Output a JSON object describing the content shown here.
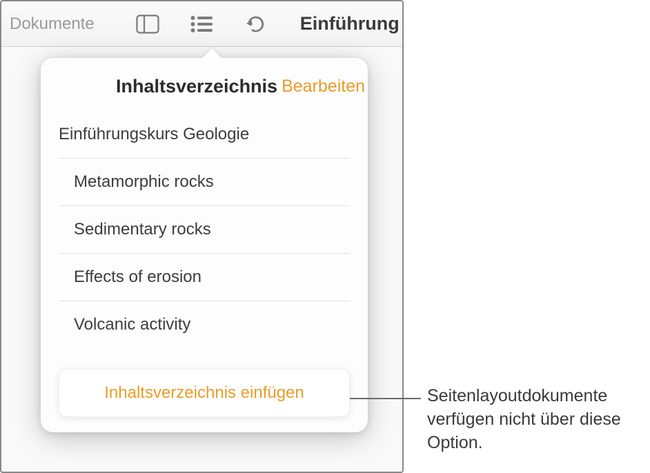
{
  "toolbar": {
    "back_label": "Dokumente",
    "doc_title": "Einführung"
  },
  "popover": {
    "title": "Inhaltsverzeichnis",
    "edit_label": "Bearbeiten",
    "items": [
      {
        "label": "Einführungskurs Geologie",
        "level": 0
      },
      {
        "label": "Metamorphic rocks",
        "level": 1
      },
      {
        "label": "Sedimentary rocks",
        "level": 1
      },
      {
        "label": "Effects of erosion",
        "level": 1
      },
      {
        "label": "Volcanic activity",
        "level": 1
      }
    ],
    "insert_label": "Inhaltsverzeichnis einfügen"
  },
  "callout": {
    "text": "Seitenlayoutdokumente verfügen nicht über diese Option."
  },
  "colors": {
    "accent": "#e89c2a"
  }
}
